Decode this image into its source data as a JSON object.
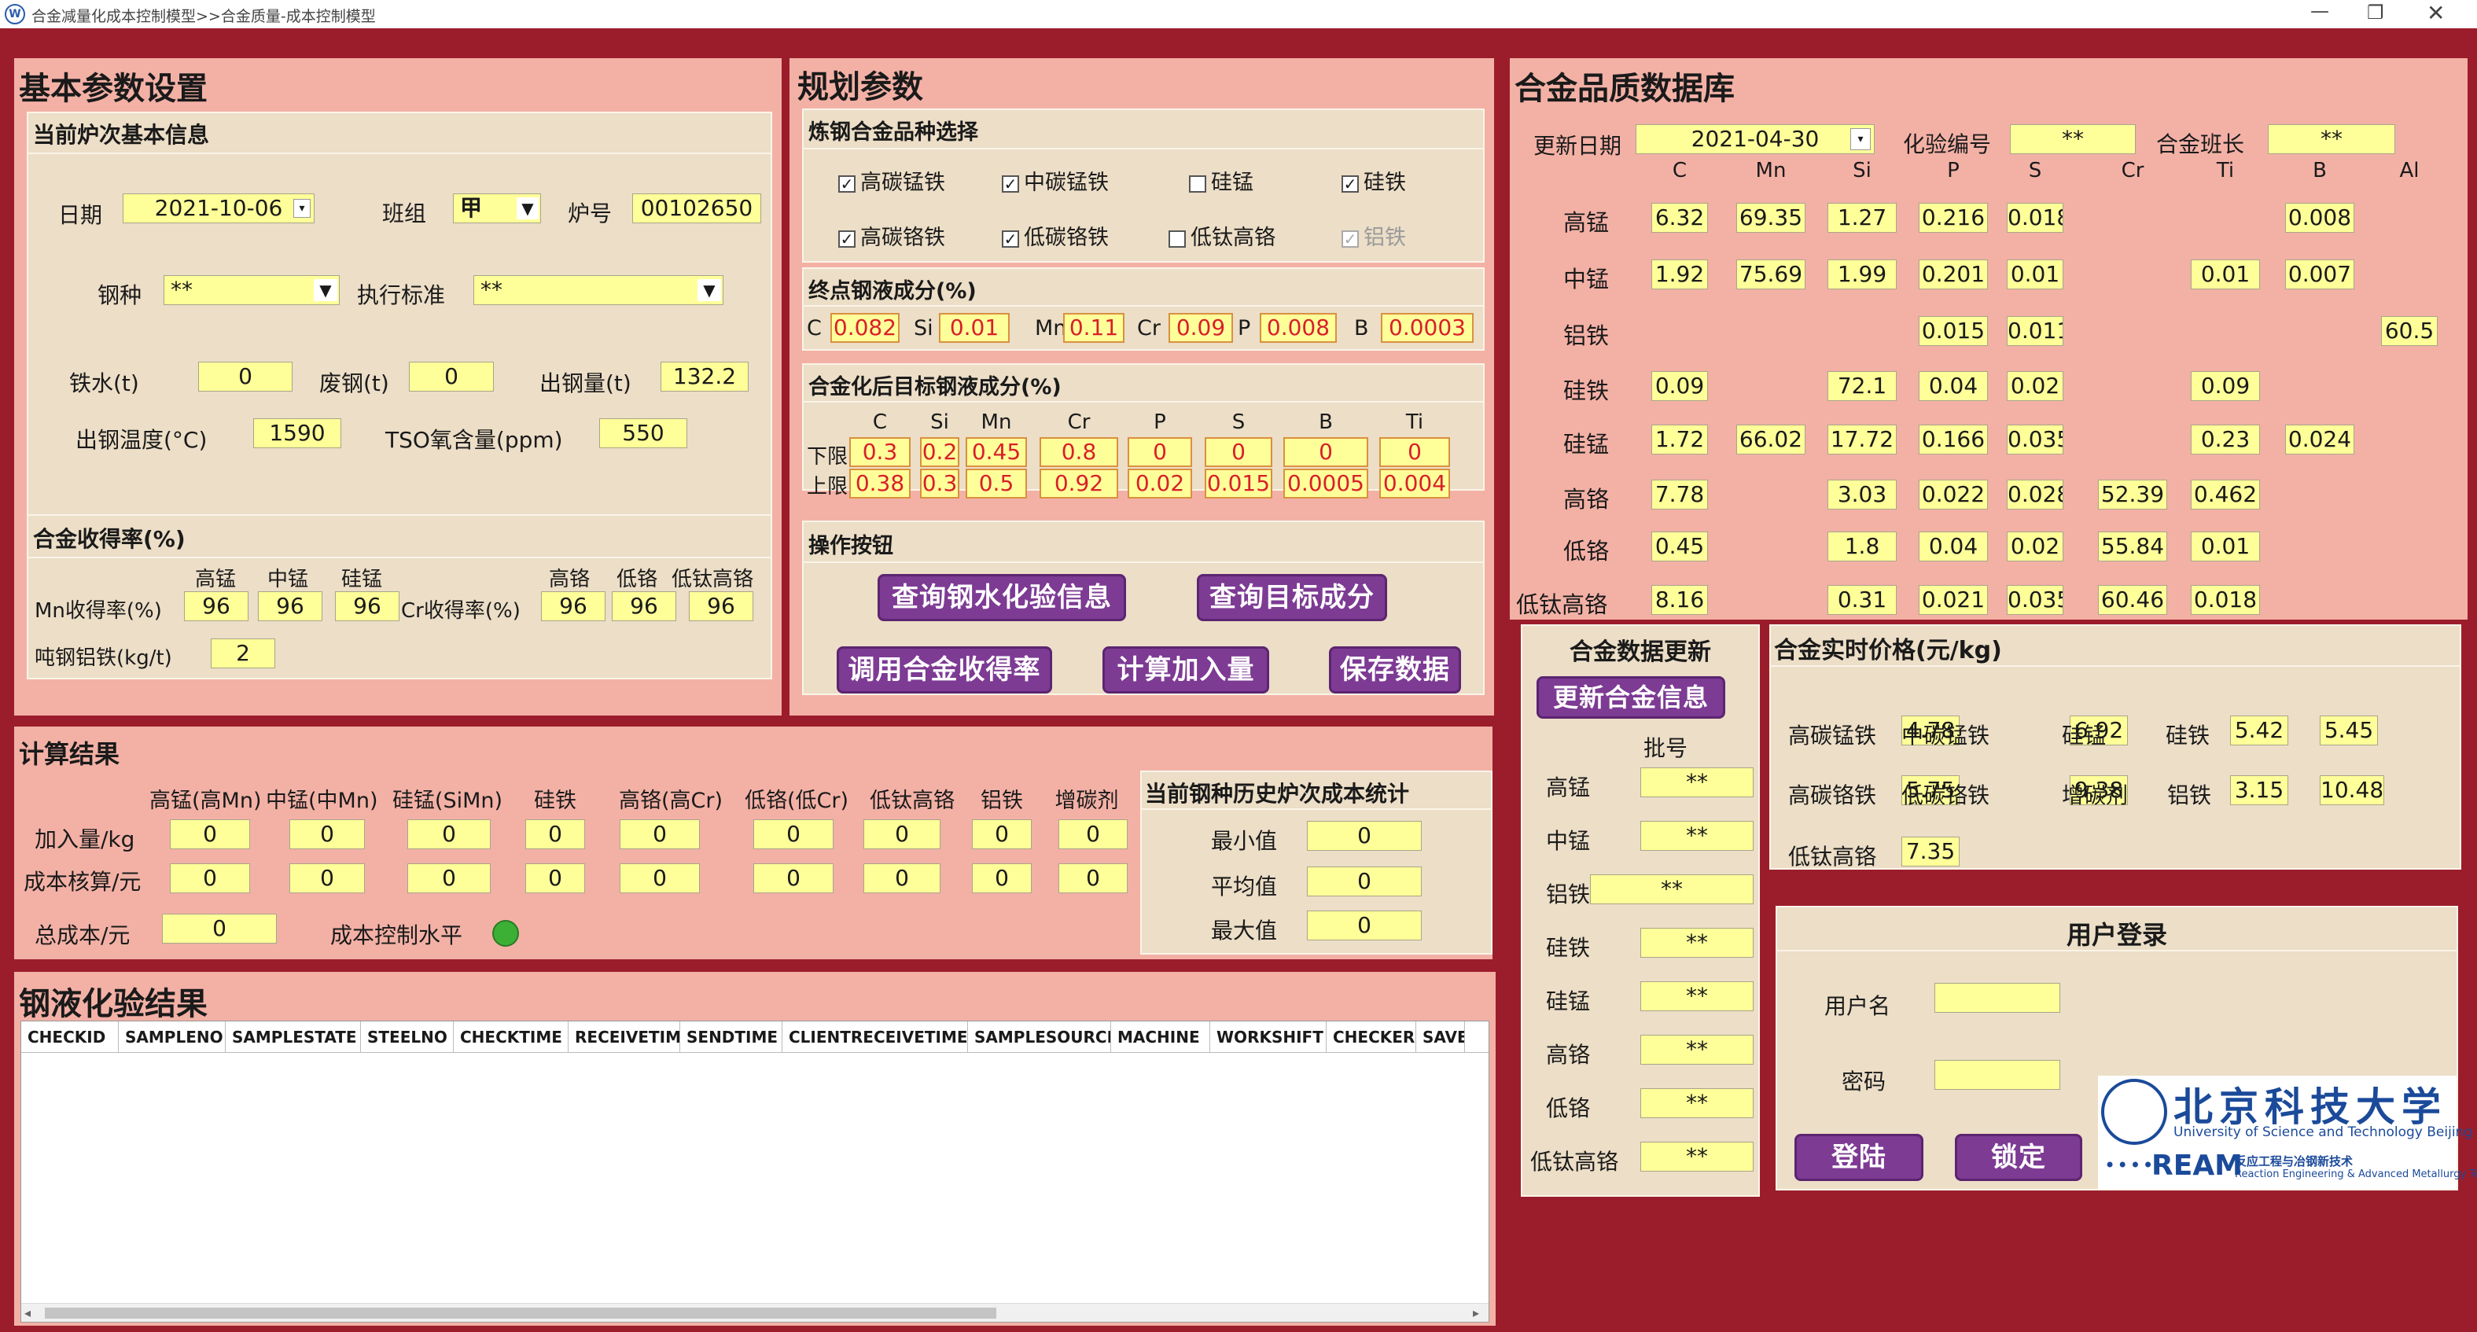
{
  "window": {
    "title": "合金减量化成本控制模型>>合金质量-成本控制模型"
  },
  "basic": {
    "title": "基本参数设置",
    "furnace_title": "当前炉次基本信息",
    "date_label": "日期",
    "date_value": "2021-10-06",
    "shift_label": "班组",
    "shift_value": "甲",
    "furnace_label": "炉号",
    "furnace_value": "00102650",
    "steel_label": "钢种",
    "steel_value": "**",
    "std_label": "执行标准",
    "std_value": "**",
    "iron_label": "铁水(t)",
    "iron_value": "0",
    "scrap_label": "废钢(t)",
    "scrap_value": "0",
    "tap_label": "出钢量(t)",
    "tap_value": "132.2",
    "temp_label": "出钢温度(°C)",
    "temp_value": "1590",
    "tso_label": "TSO氧含量(ppm)",
    "tso_value": "550"
  },
  "yield": {
    "title": "合金收得率(%)",
    "mn_label": "Mn收得率(%)",
    "cr_label": "Cr收得率(%)",
    "mn_cols": [
      "高锰",
      "中锰",
      "硅锰"
    ],
    "mn_values": [
      "96",
      "96",
      "96"
    ],
    "cr_cols": [
      "高铬",
      "低铬",
      "低钛高铬"
    ],
    "cr_values": [
      "96",
      "96",
      "96"
    ],
    "al_label": "吨钢铝铁(kg/t)",
    "al_value": "2"
  },
  "plan": {
    "title": "规划参数",
    "alloy_title": "炼钢合金品种选择",
    "alloys": [
      {
        "label": "高碳锰铁",
        "checked": "✓"
      },
      {
        "label": "中碳锰铁",
        "checked": "✓"
      },
      {
        "label": "硅锰",
        "checked": ""
      },
      {
        "label": "硅铁",
        "checked": "✓"
      },
      {
        "label": "高碳铬铁",
        "checked": "✓"
      },
      {
        "label": "低碳铬铁",
        "checked": "✓"
      },
      {
        "label": "低钛高铬",
        "checked": ""
      },
      {
        "label": "铝铁",
        "checked": "✓"
      }
    ],
    "end_title": "终点钢液成分(%)",
    "end": [
      {
        "el": "C",
        "v": "0.082"
      },
      {
        "el": "Si",
        "v": "0.01"
      },
      {
        "el": "Mn",
        "v": "0.11"
      },
      {
        "el": "Cr",
        "v": "0.09"
      },
      {
        "el": "P",
        "v": "0.008"
      },
      {
        "el": "B",
        "v": "0.0003"
      }
    ],
    "target_title": "合金化后目标钢液成分(%)",
    "target_cols": [
      "C",
      "Si",
      "Mn",
      "Cr",
      "P",
      "S",
      "B",
      "Ti"
    ],
    "lower_label": "下限",
    "upper_label": "上限",
    "lower": [
      "0.3",
      "0.2",
      "0.45",
      "0.8",
      "0",
      "0",
      "0",
      "0"
    ],
    "upper": [
      "0.38",
      "0.3",
      "0.5",
      "0.92",
      "0.02",
      "0.015",
      "0.0005",
      "0.004"
    ],
    "ops_title": "操作按钮",
    "btn_query_water": "查询钢水化验信息",
    "btn_query_target": "查询目标成分",
    "btn_yield": "调用合金收得率",
    "btn_calc": "计算加入量",
    "btn_save": "保存数据"
  },
  "quality": {
    "title": "合金品质数据库",
    "update_label": "更新日期",
    "update_value": "2021-04-30",
    "test_label": "化验编号",
    "test_value": "**",
    "leader_label": "合金班长",
    "leader_value": "**",
    "cols": [
      "C",
      "Mn",
      "Si",
      "P",
      "S",
      "Cr",
      "Ti",
      "B",
      "Al"
    ],
    "rows": [
      {
        "name": "高锰",
        "v": [
          "6.32",
          "69.35",
          "1.27",
          "0.216",
          "0.018",
          "",
          "",
          "0.008",
          ""
        ]
      },
      {
        "name": "中锰",
        "v": [
          "1.92",
          "75.69",
          "1.99",
          "0.201",
          "0.01",
          "",
          "0.01",
          "0.007",
          ""
        ]
      },
      {
        "name": "铝铁",
        "v": [
          "",
          "",
          "",
          "0.015",
          "0.011",
          "",
          "",
          "",
          "60.5"
        ]
      },
      {
        "name": "硅铁",
        "v": [
          "0.09",
          "",
          "72.1",
          "0.04",
          "0.02",
          "",
          "0.09",
          "",
          ""
        ]
      },
      {
        "name": "硅锰",
        "v": [
          "1.72",
          "66.02",
          "17.72",
          "0.166",
          "0.035",
          "",
          "0.23",
          "0.024",
          ""
        ]
      },
      {
        "name": "高铬",
        "v": [
          "7.78",
          "",
          "3.03",
          "0.022",
          "0.028",
          "52.39",
          "0.462",
          "",
          ""
        ]
      },
      {
        "name": "低铬",
        "v": [
          "0.45",
          "",
          "1.8",
          "0.04",
          "0.02",
          "55.84",
          "0.01",
          "",
          ""
        ]
      },
      {
        "name": "低钛高铬",
        "v": [
          "8.16",
          "",
          "0.31",
          "0.021",
          "0.035",
          "60.46",
          "0.018",
          "",
          ""
        ]
      }
    ]
  },
  "update": {
    "title": "合金数据更新",
    "btn": "更新合金信息",
    "batch_label": "批号",
    "items": [
      {
        "name": "高锰",
        "v": "**"
      },
      {
        "name": "中锰",
        "v": "**"
      },
      {
        "name": "铝铁",
        "v": "**"
      },
      {
        "name": "硅铁",
        "v": "**"
      },
      {
        "name": "硅锰",
        "v": "**"
      },
      {
        "name": "高铬",
        "v": "**"
      },
      {
        "name": "低铬",
        "v": "**"
      },
      {
        "name": "低钛高铬",
        "v": "**"
      }
    ]
  },
  "price": {
    "title": "合金实时价格(元/kg)",
    "items": [
      {
        "name": "高碳锰铁",
        "v": "4.78"
      },
      {
        "name": "中碳锰铁",
        "v": "6.92"
      },
      {
        "name": "硅锰",
        "v": "5.42"
      },
      {
        "name": "硅铁",
        "v": "5.45"
      },
      {
        "name": "高碳铬铁",
        "v": "5.75"
      },
      {
        "name": "低碳铬铁",
        "v": "9.38"
      },
      {
        "name": "增碳剂",
        "v": "3.15"
      },
      {
        "name": "铝铁",
        "v": "10.48"
      },
      {
        "name": "低钛高铬",
        "v": "7.35"
      }
    ]
  },
  "login": {
    "title": "用户登录",
    "user_label": "用户名",
    "user_value": "",
    "pwd_label": "密码",
    "pwd_value": "",
    "btn_login": "登陆",
    "btn_lock": "锁定",
    "logo_cn": "北京科技大学",
    "logo_en": "University of Science and Technology Beijing",
    "logo_ream": "REAM",
    "logo_ream_cn": "反应工程与冶钢新技术",
    "logo_ream_en": "Reaction Engineering & Advanced Metallurgy Team"
  },
  "calc": {
    "title": "计算结果",
    "cols": [
      "高锰(高Mn)",
      "中锰(中Mn)",
      "硅锰(SiMn)",
      "硅铁",
      "高铬(高Cr)",
      "低铬(低Cr)",
      "低钛高铬",
      "铝铁",
      "增碳剂"
    ],
    "add_label": "加入量/kg",
    "add": [
      "0",
      "0",
      "0",
      "0",
      "0",
      "0",
      "0",
      "0",
      "0"
    ],
    "cost_label": "成本核算/元",
    "cost": [
      "0",
      "0",
      "0",
      "0",
      "0",
      "0",
      "0",
      "0",
      "0"
    ],
    "total_label": "总成本/元",
    "total_value": "0",
    "level_label": "成本控制水平",
    "level_color": "#3cb034"
  },
  "history": {
    "title": "当前钢种历史炉次成本统计",
    "min_label": "最小值",
    "min_value": "0",
    "avg_label": "平均值",
    "avg_value": "0",
    "max_label": "最大值",
    "max_value": "0"
  },
  "assay": {
    "title": "钢液化验结果",
    "columns": [
      "CHECKID",
      "SAMPLENO",
      "SAMPLESTATE",
      "STEELNO",
      "CHECKTIME",
      "RECEIVETIME",
      "SENDTIME",
      "CLIENTRECEIVETIME",
      "SAMPLESOURCE",
      "MACHINE",
      "WORKSHIFT",
      "CHECKER",
      "SAVE"
    ]
  }
}
